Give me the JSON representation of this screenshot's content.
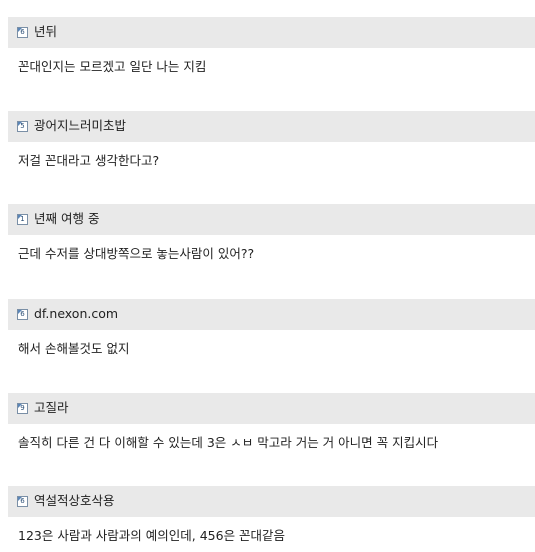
{
  "comments": [
    {
      "level": "6",
      "nickname": "년뒤",
      "text": "꼰대인지는 모르겠고 일단 나는 지킴"
    },
    {
      "level": "5",
      "nickname": "광어지느러미초밥",
      "text": "저걸 꼰대라고 생각한다고?"
    },
    {
      "level": "1",
      "nickname": "년째 여행 중",
      "text": "근데 수저를 상대방쪽으로 놓는사람이 있어??"
    },
    {
      "level": "6",
      "nickname": "df.nexon.com",
      "text": "해서 손해볼것도 없지"
    },
    {
      "level": "9",
      "nickname": "고질라",
      "text": "솔직히 다른 건 다 이해할 수 있는데 3은 ㅅㅂ 막고라 거는 거 아니면 꼭 지킵시다"
    },
    {
      "level": "6",
      "nickname": "역설적상호삭용",
      "text": "123은 사람과 사람과의 예의인데, 456은 꼰대같음"
    }
  ],
  "colors": {
    "header_bg": "#e9e9e9",
    "text": "#222222",
    "icon_border": "#7a8fa6"
  }
}
